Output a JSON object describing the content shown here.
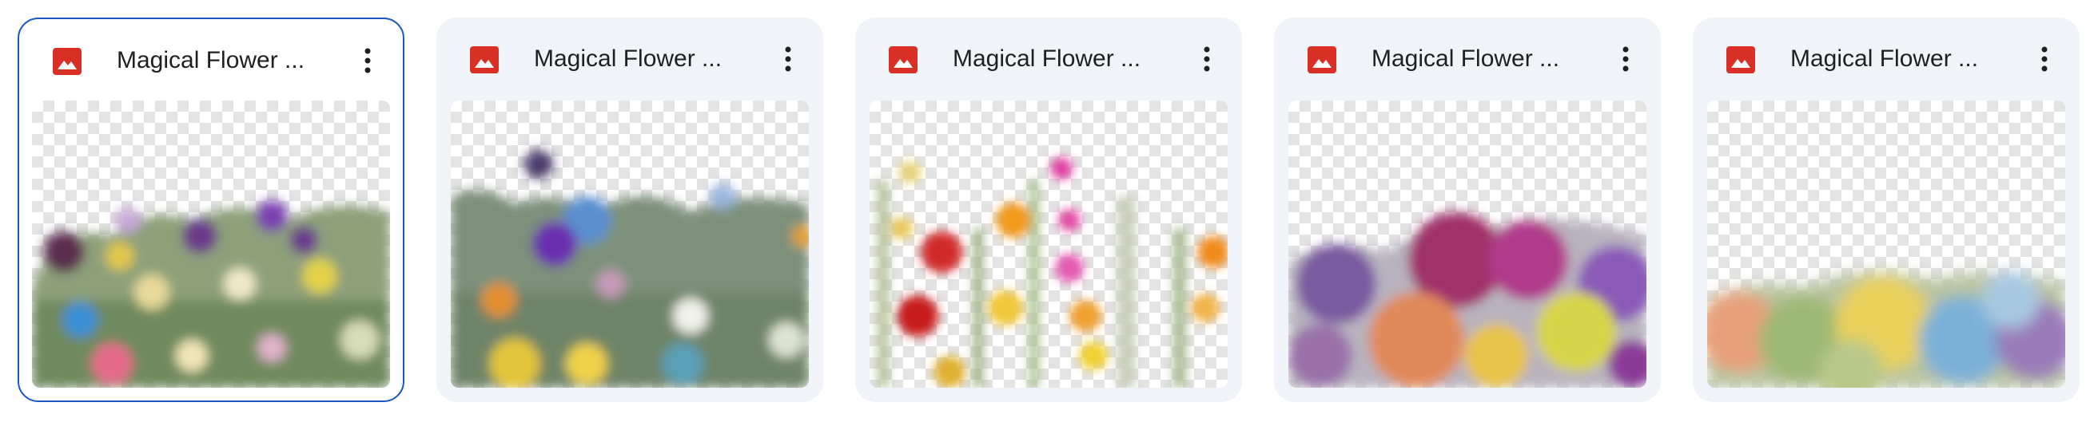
{
  "files": [
    {
      "title": "Magical Flower ...",
      "icon": "image-icon",
      "selected": true
    },
    {
      "title": "Magical Flower ...",
      "icon": "image-icon",
      "selected": false
    },
    {
      "title": "Magical Flower ...",
      "icon": "image-icon",
      "selected": false
    },
    {
      "title": "Magical Flower ...",
      "icon": "image-icon",
      "selected": false
    },
    {
      "title": "Magical Flower ...",
      "icon": "image-icon",
      "selected": false
    }
  ],
  "colors": {
    "card_bg": "#f0f4f9",
    "selected_border": "#1a57c5",
    "icon_red": "#d93025",
    "title_text": "#1f1f1f"
  }
}
